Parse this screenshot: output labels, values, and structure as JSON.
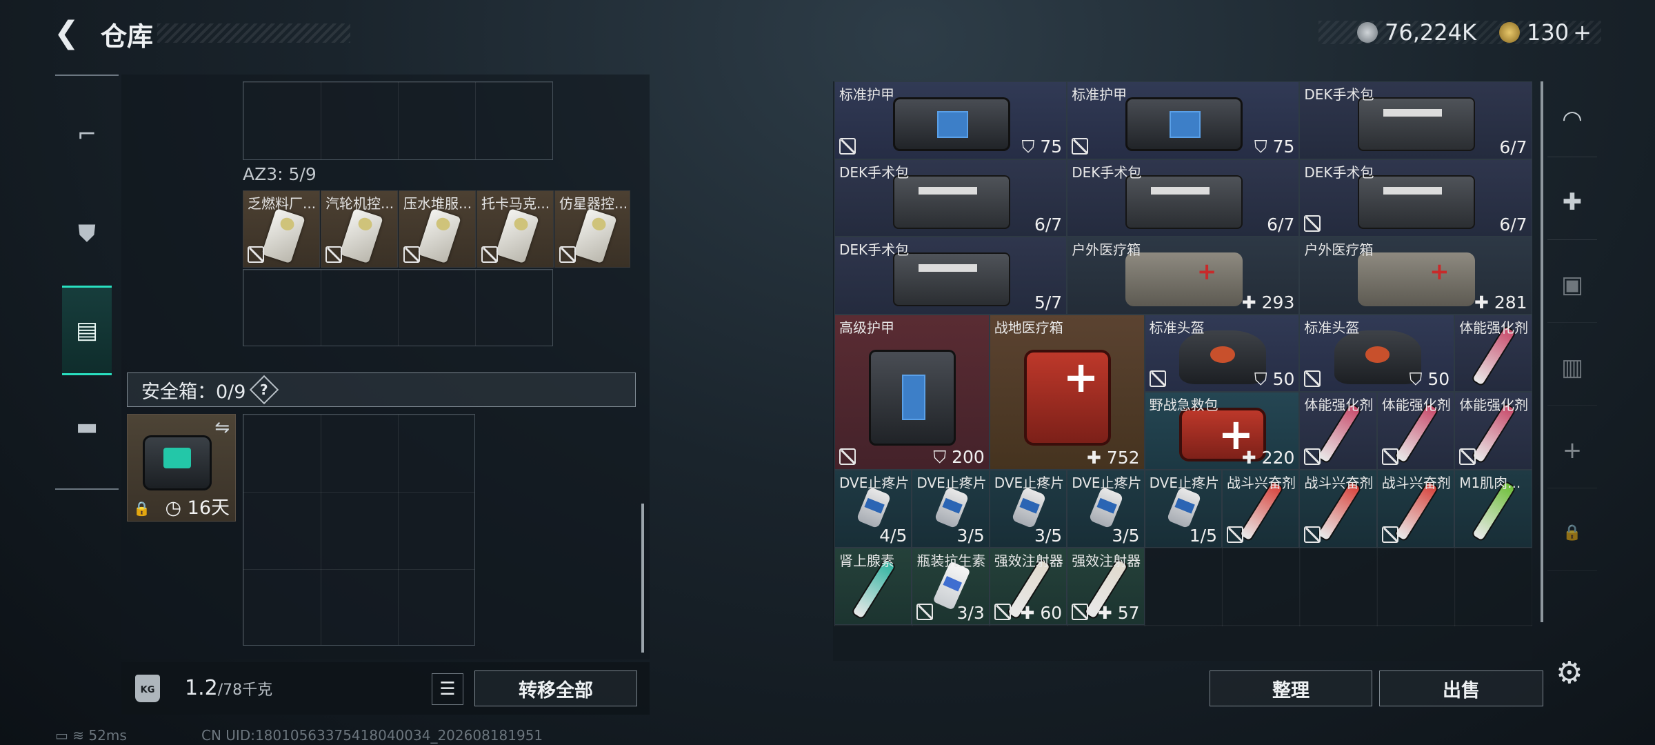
{
  "header": {
    "back_icon": "chevron-left-icon",
    "title": "仓库"
  },
  "currency": {
    "coin": "76,224K",
    "gold": "130",
    "plus": "+"
  },
  "left_nav": [
    {
      "name": "weapons",
      "icon": "gun-icon",
      "glyph": "⌐"
    },
    {
      "name": "armor",
      "icon": "armor-icon",
      "glyph": "⛊"
    },
    {
      "name": "backpack",
      "icon": "backpack-icon",
      "glyph": "▤",
      "active": true
    },
    {
      "name": "case",
      "icon": "briefcase-icon",
      "glyph": "▬"
    }
  ],
  "container": {
    "label": "AZ3: 5/9",
    "items": [
      {
        "name": "乏燃料厂...",
        "undroppable": true
      },
      {
        "name": "汽轮机控...",
        "undroppable": true
      },
      {
        "name": "压水堆服...",
        "undroppable": true
      },
      {
        "name": "托卡马克...",
        "undroppable": true
      },
      {
        "name": "仿星器控...",
        "undroppable": true
      }
    ]
  },
  "safe_box": {
    "label": "安全箱：0/9",
    "help": "?",
    "time": "16天",
    "swap_icon": "swap-icon",
    "lock_icon": "lock-icon",
    "clock_icon": "clock-icon"
  },
  "weight": {
    "icon_text": "KG",
    "current": "1.2",
    "max": "/78千克"
  },
  "buttons": {
    "list_icon": "list-icon",
    "transfer_all": "转移全部",
    "sort": "整理",
    "sell": "出售"
  },
  "status": {
    "ping": "52ms",
    "uid": "CN UID:18010563375418040034_202608181951"
  },
  "stash": [
    {
      "name": "标准护甲",
      "count": "75",
      "prefix": "shield",
      "undroppable": true
    },
    {
      "name": "标准护甲",
      "count": "75",
      "prefix": "shield",
      "undroppable": true
    },
    {
      "name": "DEK手术包",
      "count": "6/7",
      "undroppable": false
    },
    {
      "name": "DEK手术包",
      "count": "6/7",
      "undroppable": false
    },
    {
      "name": "DEK手术包",
      "count": "6/7",
      "undroppable": false
    },
    {
      "name": "DEK手术包",
      "count": "6/7",
      "undroppable": true
    },
    {
      "name": "DEK手术包",
      "count": "5/7",
      "undroppable": false
    },
    {
      "name": "户外医疗箱",
      "count": "293",
      "prefix": "plus",
      "undroppable": false
    },
    {
      "name": "户外医疗箱",
      "count": "281",
      "prefix": "plus",
      "undroppable": false
    },
    {
      "name": "高级护甲",
      "count": "200",
      "prefix": "shield",
      "undroppable": true
    },
    {
      "name": "战地医疗箱",
      "count": "752",
      "prefix": "plus",
      "undroppable": false
    },
    {
      "name": "标准头盔",
      "count": "50",
      "prefix": "shield",
      "undroppable": true
    },
    {
      "name": "标准头盔",
      "count": "50",
      "prefix": "shield",
      "undroppable": true
    },
    {
      "name": "体能强化剂",
      "count": "",
      "undroppable": false
    },
    {
      "name": "野战急救包",
      "count": "220",
      "prefix": "plus",
      "undroppable": false
    },
    {
      "name": "体能强化剂",
      "count": "",
      "undroppable": true
    },
    {
      "name": "体能强化剂",
      "count": "",
      "undroppable": true
    },
    {
      "name": "体能强化剂",
      "count": "",
      "undroppable": true
    },
    {
      "name": "DVE止疼片",
      "count": "4/5",
      "undroppable": false
    },
    {
      "name": "DVE止疼片",
      "count": "3/5",
      "undroppable": false
    },
    {
      "name": "DVE止疼片",
      "count": "3/5",
      "undroppable": false
    },
    {
      "name": "DVE止疼片",
      "count": "3/5",
      "undroppable": false
    },
    {
      "name": "DVE止疼片",
      "count": "1/5",
      "undroppable": false
    },
    {
      "name": "战斗兴奋剂",
      "count": "",
      "undroppable": true
    },
    {
      "name": "战斗兴奋剂",
      "count": "",
      "undroppable": true
    },
    {
      "name": "战斗兴奋剂",
      "count": "",
      "undroppable": true
    },
    {
      "name": "M1肌肉...",
      "count": "",
      "undroppable": false
    },
    {
      "name": "肾上腺素",
      "count": "",
      "undroppable": false
    },
    {
      "name": "瓶装抗生素",
      "count": "3/3",
      "undroppable": true
    },
    {
      "name": "强效注射器",
      "count": "60",
      "prefix": "plus",
      "undroppable": true
    },
    {
      "name": "强效注射器",
      "count": "57",
      "prefix": "plus",
      "undroppable": true
    }
  ],
  "right_nav": [
    {
      "name": "helmet",
      "icon": "helmet-icon",
      "glyph": "◠"
    },
    {
      "name": "medkit-add",
      "icon": "medkit-add-icon",
      "glyph": "✚"
    },
    {
      "name": "armor-level",
      "icon": "armor-level-icon",
      "glyph": "▣"
    },
    {
      "name": "backpack-level",
      "icon": "backpack-level-icon",
      "glyph": "▥"
    },
    {
      "name": "add",
      "icon": "plus-icon",
      "glyph": "+"
    },
    {
      "name": "lock",
      "icon": "lock-icon",
      "glyph": "🔒"
    }
  ],
  "settings_icon": "gear-icon"
}
